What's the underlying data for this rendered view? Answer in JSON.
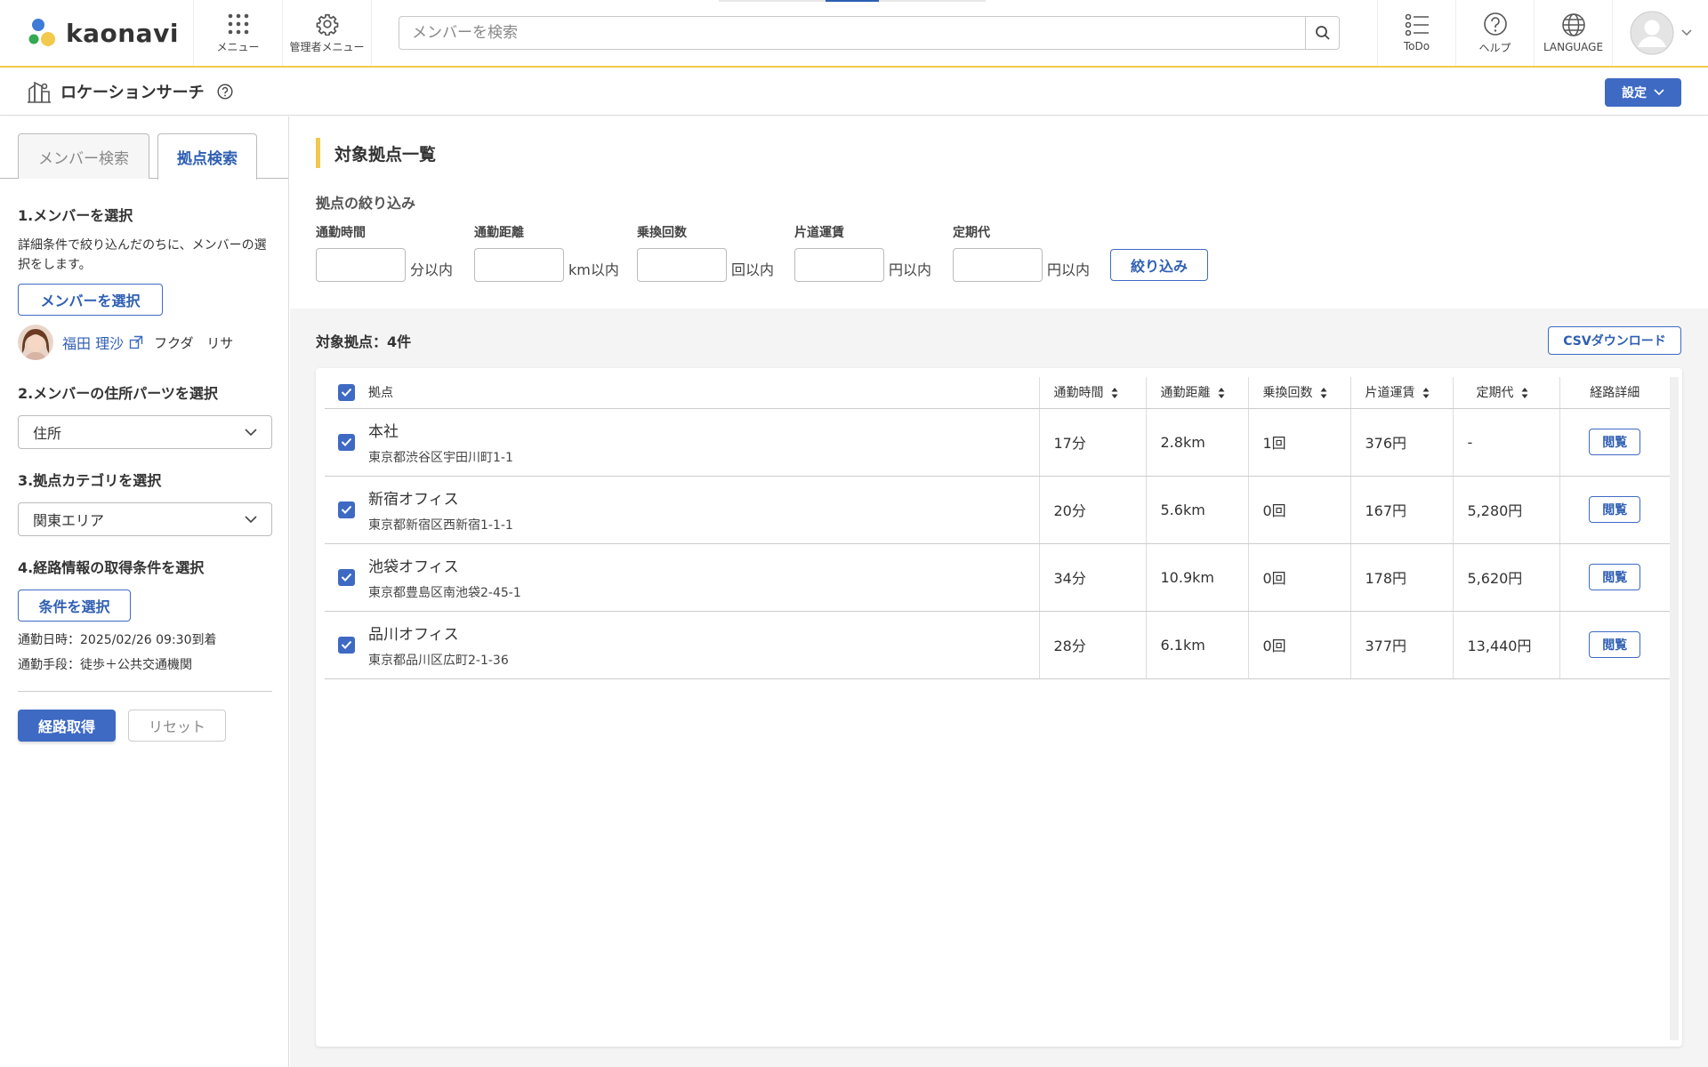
{
  "header": {
    "brand": "kaonavi",
    "menu_label": "メニュー",
    "admin_menu_label": "管理者メニュー",
    "search_placeholder": "メンバーを検索",
    "todo_label": "ToDo",
    "help_label": "ヘルプ",
    "language_label": "LANGUAGE"
  },
  "subheader": {
    "title": "ロケーションサーチ",
    "settings_label": "設定"
  },
  "left": {
    "tabs": [
      {
        "label": "メンバー検索",
        "active": false
      },
      {
        "label": "拠点検索",
        "active": true
      }
    ],
    "step1_title": "1.メンバーを選択",
    "step1_desc": "詳細条件で絞り込んだのちに、メンバーの選択をします。",
    "select_member_button": "メンバーを選択",
    "member": {
      "name": "福田 理沙",
      "kana": "フクダ リサ"
    },
    "step2_title": "2.メンバーの住所パーツを選択",
    "address_part_value": "住所",
    "step3_title": "3.拠点カテゴリを選択",
    "category_value": "関東エリア",
    "step4_title": "4.経路情報の取得条件を選択",
    "select_condition_button": "条件を選択",
    "commute_datetime": "通勤日時：2025/02/26 09:30到着",
    "commute_method": "通勤手段：徒歩＋公共交通機関",
    "get_route_button": "経路取得",
    "reset_button": "リセット"
  },
  "main": {
    "section_title": "対象拠点一覧",
    "filter_title": "拠点の絞り込み",
    "filters": [
      {
        "label": "通勤時間",
        "unit": "分以内"
      },
      {
        "label": "通勤距離",
        "unit": "km以内"
      },
      {
        "label": "乗換回数",
        "unit": "回以内"
      },
      {
        "label": "片道運賃",
        "unit": "円以内"
      },
      {
        "label": "定期代",
        "unit": "円以内"
      }
    ],
    "filter_button": "絞り込み",
    "result_count": "対象拠点：4件",
    "csv_button": "CSVダウンロード",
    "table": {
      "headers": {
        "base": "拠点",
        "time": "通勤時間",
        "distance": "通勤距離",
        "transfers": "乗換回数",
        "fare": "片道運賃",
        "pass": "定期代",
        "detail": "経路詳細"
      },
      "view_label": "閲覧",
      "rows": [
        {
          "name": "本社",
          "address": "東京都渋谷区宇田川町1-1",
          "time": "17分",
          "distance": "2.8km",
          "transfers": "1回",
          "fare": "376円",
          "pass": "-"
        },
        {
          "name": "新宿オフィス",
          "address": "東京都新宿区西新宿1-1-1",
          "time": "20分",
          "distance": "5.6km",
          "transfers": "0回",
          "fare": "167円",
          "pass": "5,280円"
        },
        {
          "name": "池袋オフィス",
          "address": "東京都豊島区南池袋2-45-1",
          "time": "34分",
          "distance": "10.9km",
          "transfers": "0回",
          "fare": "178円",
          "pass": "5,620円"
        },
        {
          "name": "品川オフィス",
          "address": "東京都品川区広町2-1-36",
          "time": "28分",
          "distance": "6.1km",
          "transfers": "0回",
          "fare": "377円",
          "pass": "13,440円"
        }
      ]
    }
  },
  "colors": {
    "accent": "#3e6ac4",
    "highlight": "#f2c94c"
  }
}
